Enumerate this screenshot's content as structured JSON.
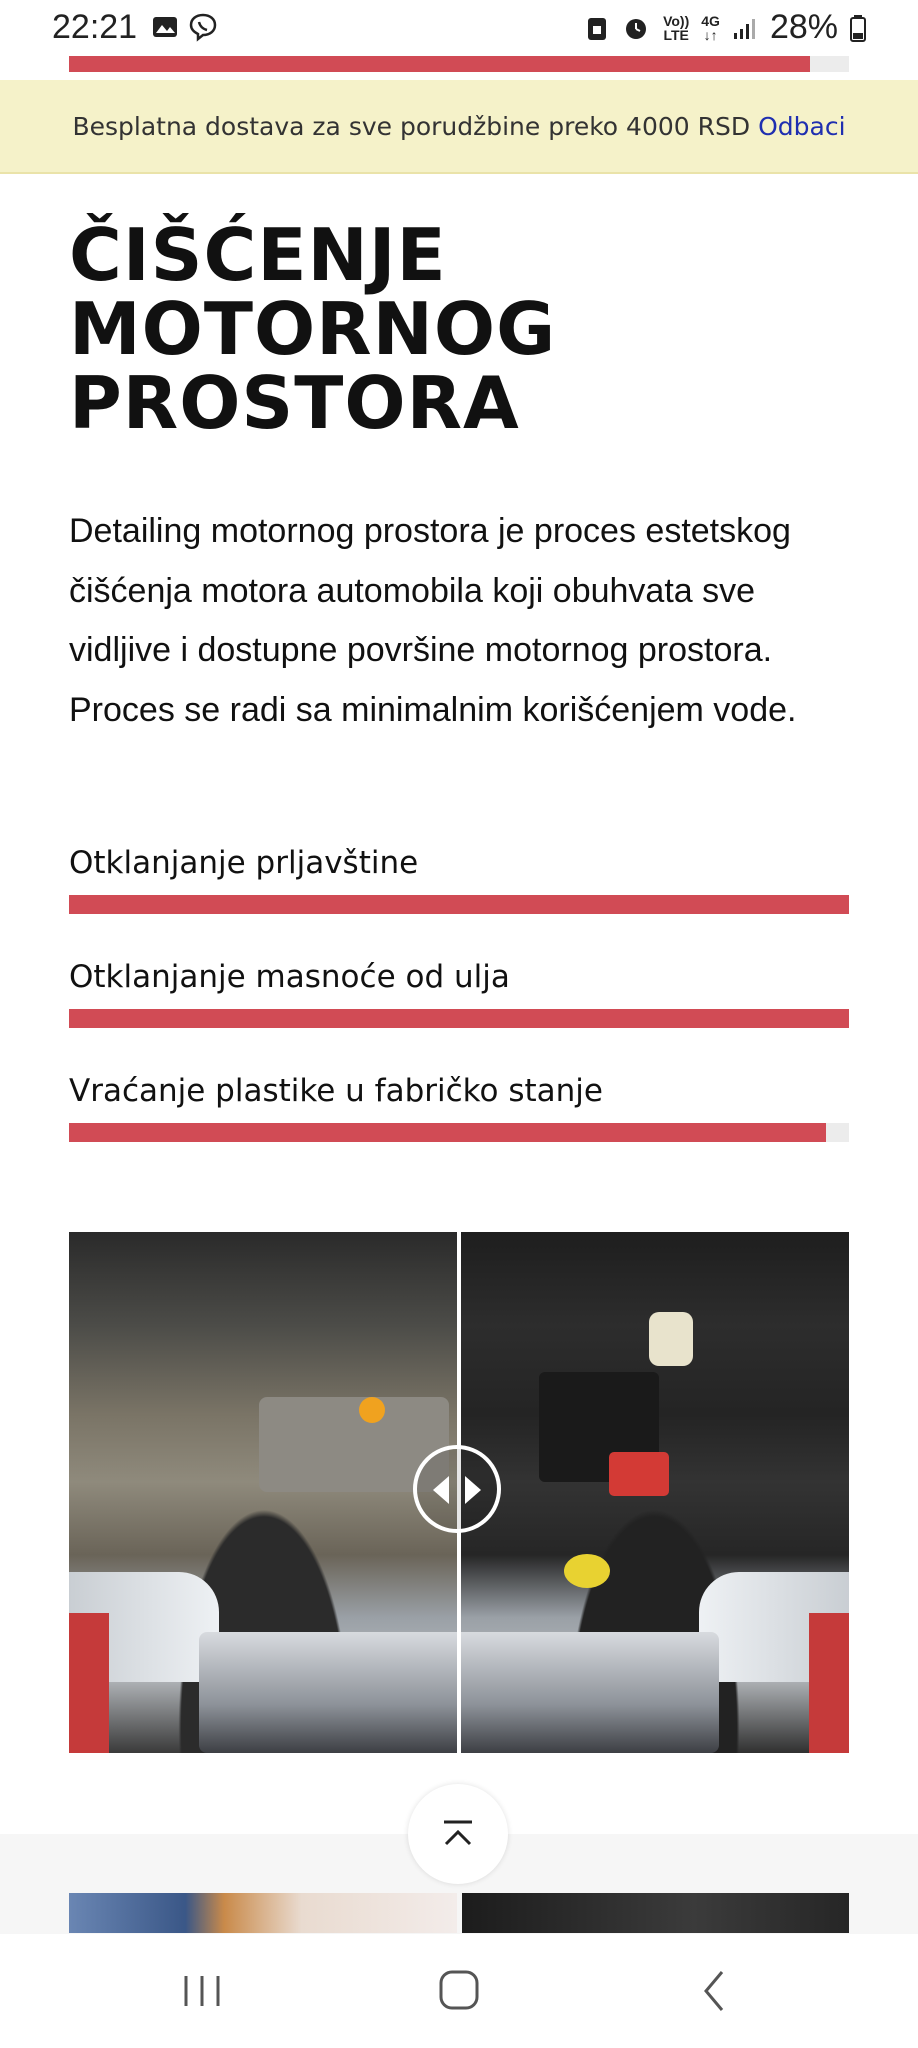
{
  "status_bar": {
    "time": "22:21",
    "battery": "28%",
    "network_top": "Vo))",
    "network_bottom": "LTE",
    "signal_label": "4G"
  },
  "scroll_progress": {
    "fraction": 0.95
  },
  "notice": {
    "text": "Besplatna dostava za sve porudžbine preko 4000 RSD",
    "dismiss_label": "Odbaci"
  },
  "title": {
    "line1": "ČIŠĆENJE",
    "line2": "MOTORNOG",
    "line3": "PROSTORA"
  },
  "intro": {
    "text": "Detailing motornog prostora je proces estetskog čišćenja motora automobila koji obuhvata sve vidljive i dostupne površine motornog prostora. Proces se radi sa minimalnim korišćenjem vode."
  },
  "skills": [
    {
      "label": "Otklanjanje prljavštine",
      "percent": 100
    },
    {
      "label": "Otklanjanje masnoće od ulja",
      "percent": 100
    },
    {
      "label": "Vraćanje plastike u fabričko stanje",
      "percent": 97
    }
  ],
  "colors": {
    "accent": "#d14b55",
    "notice_bg": "#f5f2c9",
    "link": "#1f2fb0"
  },
  "icons": {
    "back_to_top": "chevron-up-bar-icon",
    "nav_recent": "recent-apps-icon",
    "nav_home": "home-icon",
    "nav_back": "back-icon"
  }
}
